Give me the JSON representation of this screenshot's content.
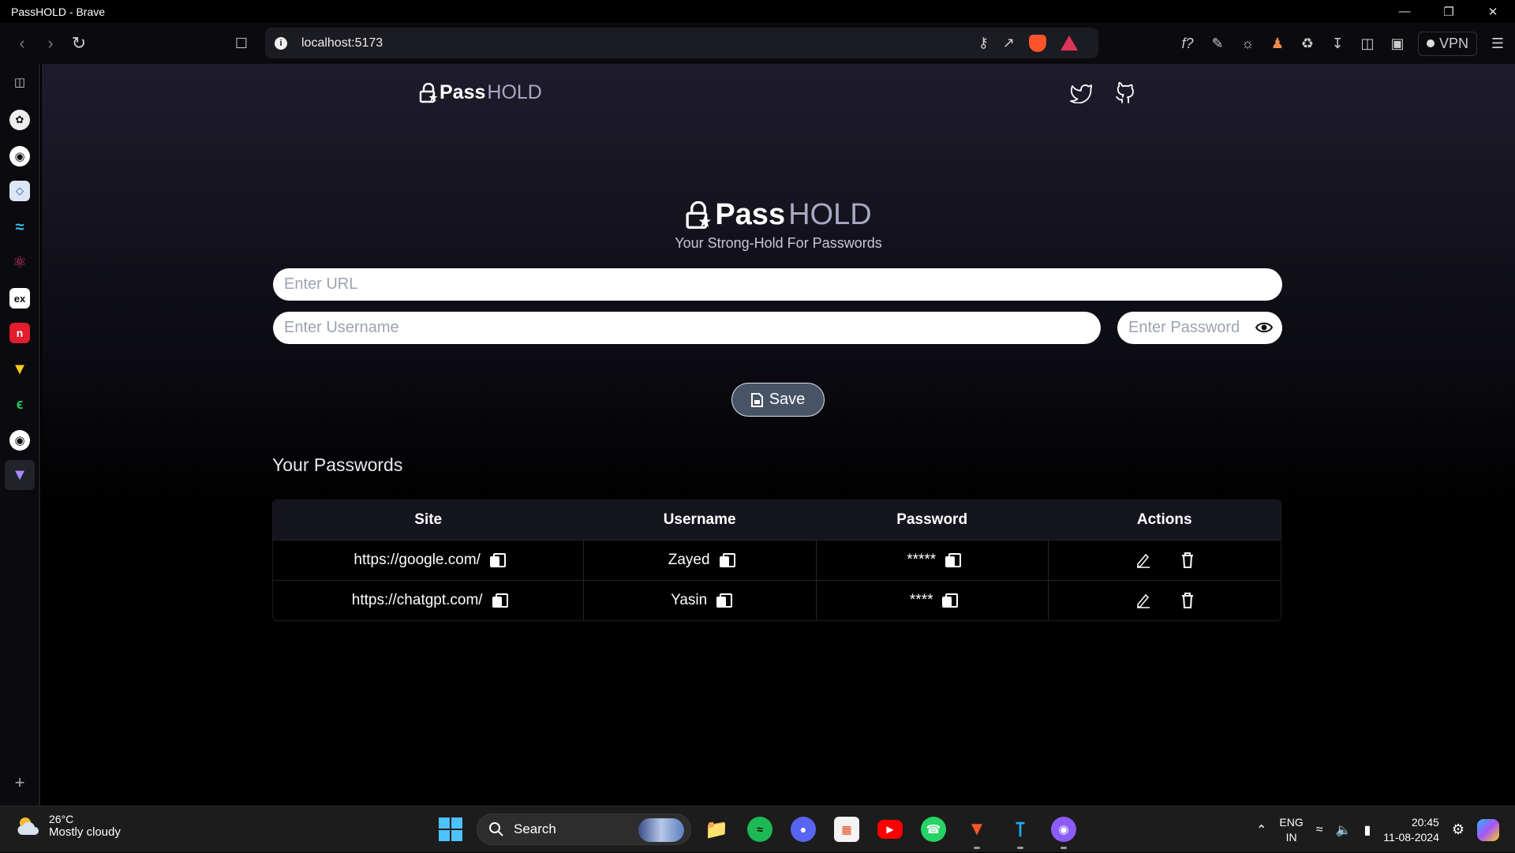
{
  "window": {
    "title": "PassHOLD - Brave"
  },
  "browser": {
    "url": "localhost:5173",
    "vpn_label": "VPN"
  },
  "app": {
    "logo": {
      "pass": "Pass",
      "hold": "HOLD"
    },
    "tagline": "Your Strong-Hold For Passwords",
    "form": {
      "url_placeholder": "Enter URL",
      "username_placeholder": "Enter Username",
      "password_placeholder": "Enter Password",
      "save_label": "Save"
    },
    "passwords_title": "Your Passwords",
    "table": {
      "headers": [
        "Site",
        "Username",
        "Password",
        "Actions"
      ],
      "rows": [
        {
          "site": "https://google.com/",
          "username": "Zayed",
          "password": "*****"
        },
        {
          "site": "https://chatgpt.com/",
          "username": "Yasin",
          "password": "****"
        }
      ]
    }
  },
  "taskbar": {
    "weather": {
      "temp": "26°C",
      "condition": "Mostly cloudy"
    },
    "search_label": "Search",
    "lang": {
      "line1": "ENG",
      "line2": "IN"
    },
    "clock": {
      "time": "20:45",
      "date": "11-08-2024"
    }
  },
  "colors": {
    "accent_hold": "#a7a9c4",
    "save_button": "#495366",
    "windows_blue": "#4cc2ff"
  }
}
